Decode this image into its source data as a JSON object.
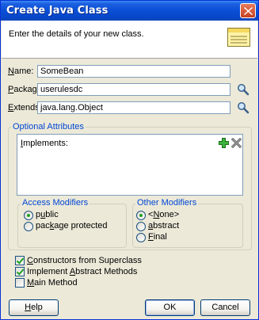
{
  "window": {
    "title": "Create Java Class"
  },
  "header": {
    "description": "Enter the details of your new class."
  },
  "fields": [
    {
      "label_prefix": "",
      "label_mnemonic": "N",
      "label_rest": "ame:",
      "value": "SomeBean"
    },
    {
      "label_prefix": "",
      "label_mnemonic": "P",
      "label_rest": "ackage:",
      "value": "userulesdc"
    },
    {
      "label_prefix": "",
      "label_mnemonic": "E",
      "label_rest": "xtends:",
      "value": "java.lang.Object"
    }
  ],
  "optional": {
    "legend": "Optional Attributes",
    "implements_mnemonic": "I",
    "implements_rest": "mplements:"
  },
  "access_modifiers": {
    "legend": "Access Modifiers",
    "options": [
      {
        "prefix": "p",
        "mnemonic": "u",
        "rest": "blic",
        "checked": true
      },
      {
        "prefix": "pac",
        "mnemonic": "k",
        "rest": "age protected",
        "checked": false
      }
    ]
  },
  "other_modifiers": {
    "legend": "Other Modifiers",
    "options": [
      {
        "prefix": "<",
        "mnemonic": "N",
        "rest": "one>",
        "checked": true
      },
      {
        "prefix": "",
        "mnemonic": "a",
        "rest": "bstract",
        "checked": false
      },
      {
        "prefix": "",
        "mnemonic": "F",
        "rest": "inal",
        "checked": false
      }
    ]
  },
  "checkboxes": [
    {
      "prefix": "",
      "mnemonic": "C",
      "rest": "onstructors from Superclass",
      "checked": true
    },
    {
      "prefix": "Implement ",
      "mnemonic": "A",
      "rest": "bstract Methods",
      "checked": true
    },
    {
      "prefix": "",
      "mnemonic": "M",
      "rest": "ain Method",
      "checked": false
    }
  ],
  "buttons": {
    "help_mnemonic": "H",
    "help_rest": "elp",
    "ok": "OK",
    "cancel": "Cancel"
  },
  "colors": {
    "title_bar": "#0a4fd6",
    "legend": "#0046d5",
    "check_mark": "#21a121"
  }
}
